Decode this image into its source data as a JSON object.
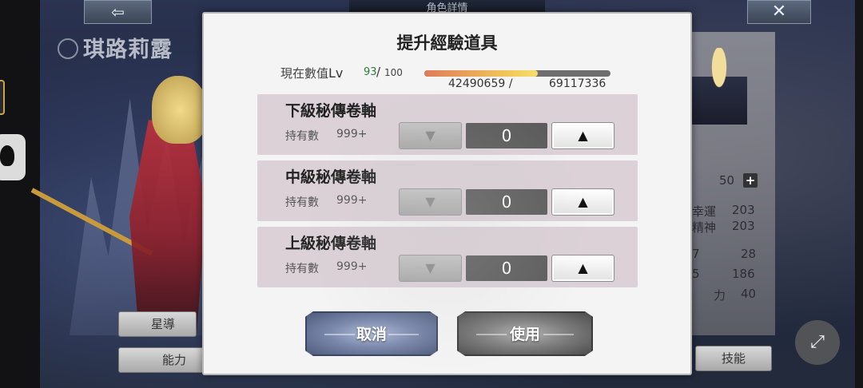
{
  "background": {
    "character_name": "琪路莉露",
    "header_center_title": "角色詳情",
    "back_glyph": "⇦",
    "close_glyph": "✕",
    "stats": {
      "top_value": "50",
      "plus_glyph": "+",
      "luck_label": "幸運",
      "luck_value": "203",
      "spirit_label": "精神",
      "spirit_value": "203",
      "row3_left": "7",
      "row3_value": "28",
      "row4_left": "5",
      "row4_value": "186",
      "power_label": "力",
      "power_value": "40"
    },
    "side_buttons": {
      "star_guide": "星導",
      "ability": "能力",
      "skill": "技能"
    }
  },
  "dialog": {
    "title": "提升經驗道具",
    "level_label": "現在數值",
    "level_abbr": "Lv",
    "level_current": "93",
    "level_separator": "/",
    "level_max": "100",
    "exp_current": "42490659 /",
    "exp_max": "69117336",
    "exp_progress": 0.61,
    "items": [
      {
        "name": "下級秘傳卷軸",
        "owned_label": "持有數",
        "owned_value": "999+",
        "quantity": "0",
        "dec_glyph": "▼",
        "inc_glyph": "▲"
      },
      {
        "name": "中級秘傳卷軸",
        "owned_label": "持有數",
        "owned_value": "999+",
        "quantity": "0",
        "dec_glyph": "▼",
        "inc_glyph": "▲"
      },
      {
        "name": "上級秘傳卷軸",
        "owned_label": "持有數",
        "owned_value": "999+",
        "quantity": "0",
        "dec_glyph": "▼",
        "inc_glyph": "▲"
      }
    ],
    "cancel_label": "取消",
    "use_label": "使用"
  },
  "colors": {
    "level_current": "#2f7a3b",
    "exp_fill_start": "#e07a58",
    "exp_fill_end": "#f5de6a"
  },
  "fullscreen_glyph": "⤢"
}
